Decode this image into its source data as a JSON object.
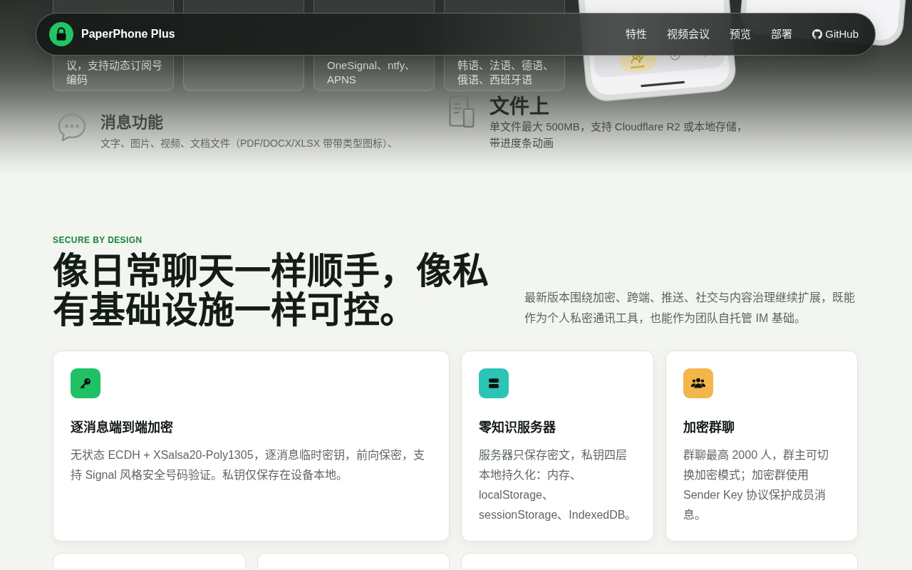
{
  "nav_bar": {
    "brand": "PaperPhone Plus",
    "links": [
      {
        "label": "特性",
        "kind": "text"
      },
      {
        "label": "视频会议",
        "kind": "text"
      },
      {
        "label": "预览",
        "kind": "text"
      },
      {
        "label": "部署",
        "kind": "text"
      },
      {
        "label": "GitHub",
        "kind": "github"
      }
    ]
  },
  "backdrop": {
    "cards": [
      {
        "kind": "text",
        "text": "议，支持动态订阅号编码"
      },
      {
        "kind": "blank"
      },
      {
        "kind": "text",
        "text": "OneSignal、ntfy、APNS"
      },
      {
        "kind": "text",
        "text": "韩语、法语、德语、俄语、西班牙语"
      }
    ],
    "features": [
      {
        "title": "消息功能",
        "text": "文字、图片、视频、文档文件（PDF/DOCX/XLSX 带带类型图标）、"
      },
      {
        "title": "文件上",
        "text": "单文件最大 500MB，支持 Cloudflare R2 或本地存储，带进度条动画"
      }
    ]
  },
  "section": {
    "eyebrow": "SECURE BY DESIGN",
    "heading": "像日常聊天一样顺手，像私有基础设施一样可控。",
    "description": "最新版本围绕加密、跨端、推送、社交与内容治理继续扩展，既能作为个人私密通讯工具，也能作为团队自托管 IM 基础。"
  },
  "cards": [
    {
      "title": "逐消息端到端加密",
      "text": "无状态 ECDH + XSalsa20-Poly1305，逐消息临时密钥，前向保密，支持 Signal 风格安全号码验证。私钥仅保存在设备本地。",
      "color": "#20c165"
    },
    {
      "title": "零知识服务器",
      "text": "服务器只保存密文，私钥四层本地持久化：内存、localStorage、sessionStorage、IndexedDB。",
      "color": "#2cc5b5"
    },
    {
      "title": "加密群聊",
      "text": "群聊最高 2000 人，群主可切换加密模式；加密群使用 Sender Key 协议保护成员消息。",
      "color": "#f3b64a"
    }
  ]
}
